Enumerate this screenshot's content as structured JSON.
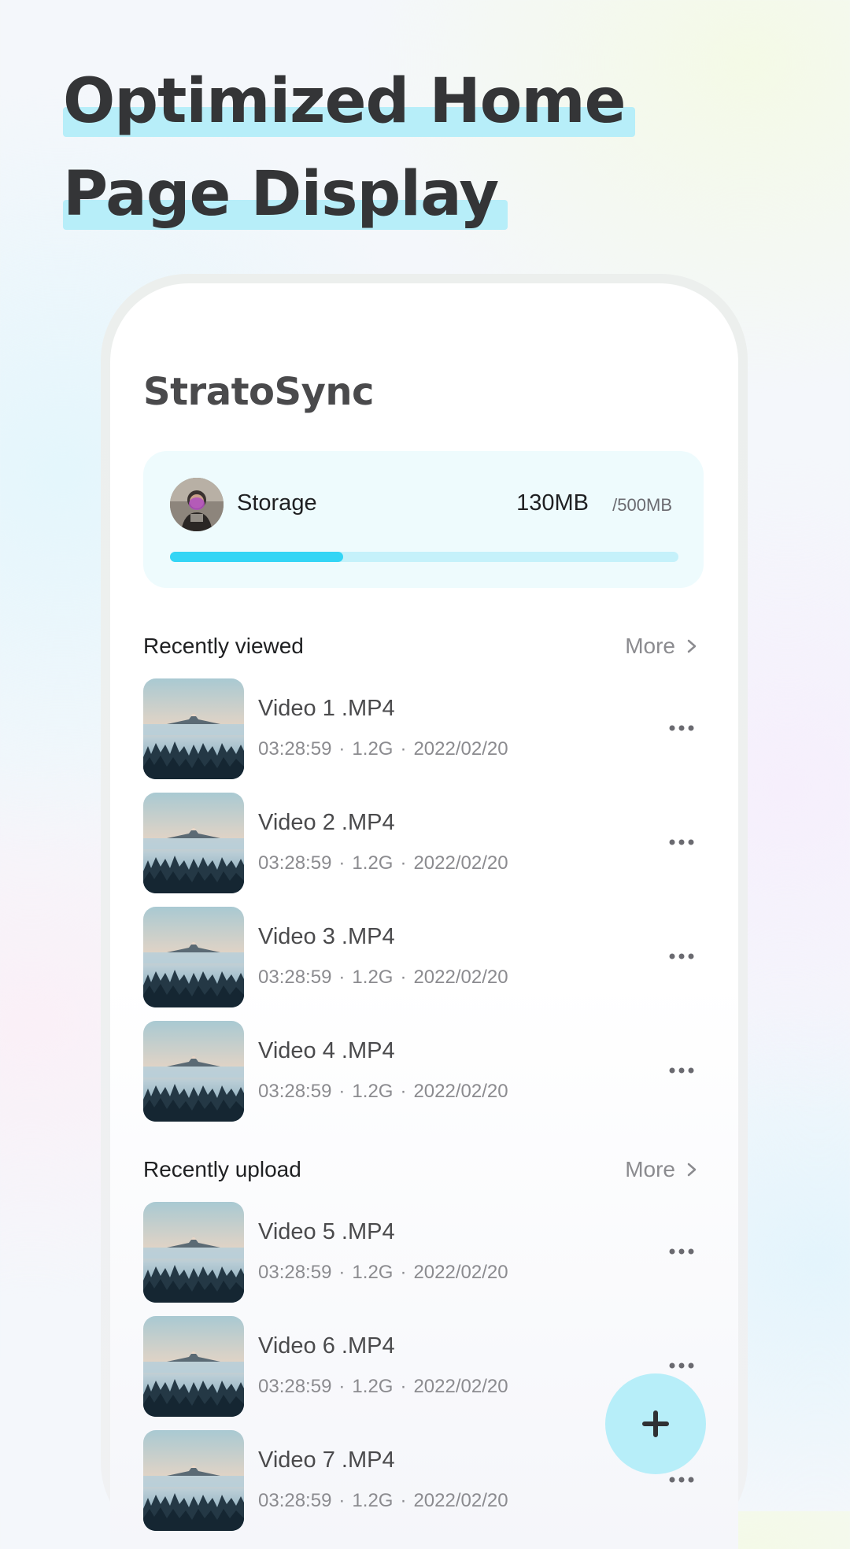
{
  "headline": {
    "line1": "Optimized Home",
    "line2": "Page Display"
  },
  "app": {
    "title": "StratoSync"
  },
  "storage": {
    "label": "Storage",
    "used": "130MB",
    "total": "/500MB",
    "used_fraction": 0.34
  },
  "sections": [
    {
      "title": "Recently viewed",
      "more_label": "More",
      "videos": [
        {
          "name": "Video 1 .MP4",
          "duration": "03:28:59",
          "size": "1.2G",
          "date": "2022/02/20"
        },
        {
          "name": "Video 2 .MP4",
          "duration": "03:28:59",
          "size": "1.2G",
          "date": "2022/02/20"
        },
        {
          "name": "Video 3 .MP4",
          "duration": "03:28:59",
          "size": "1.2G",
          "date": "2022/02/20"
        },
        {
          "name": "Video 4 .MP4",
          "duration": "03:28:59",
          "size": "1.2G",
          "date": "2022/02/20"
        }
      ]
    },
    {
      "title": "Recently upload",
      "more_label": "More",
      "videos": [
        {
          "name": "Video 5 .MP4",
          "duration": "03:28:59",
          "size": "1.2G",
          "date": "2022/02/20"
        },
        {
          "name": "Video 6 .MP4",
          "duration": "03:28:59",
          "size": "1.2G",
          "date": "2022/02/20"
        },
        {
          "name": "Video 7 .MP4",
          "duration": "03:28:59",
          "size": "1.2G",
          "date": "2022/02/20"
        }
      ]
    }
  ],
  "meta_separator": "·",
  "icons": {
    "more_chevron": "chevron-right-icon",
    "item_menu": "more-horizontal-icon",
    "fab": "plus-icon",
    "avatar": "avatar-photo",
    "thumbnail": "mountain-landscape-thumbnail"
  },
  "colors": {
    "accent": "#33d5f5",
    "accent_light": "#b7eef9",
    "card_bg": "#eefbfd",
    "text_dark": "#1f2022",
    "text_muted": "#8b8b8f"
  }
}
